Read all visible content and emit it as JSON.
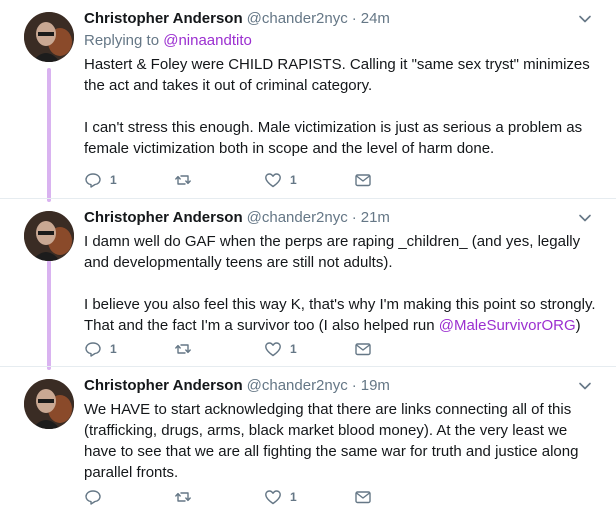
{
  "tweets": [
    {
      "name": "Christopher Anderson",
      "handle": "@chander2nyc",
      "separator": "·",
      "time": "24m",
      "replying_prefix": "Replying to ",
      "replying_to": "@ninaandtito",
      "paragraphs": [
        "Hastert & Foley were CHILD RAPISTS. Calling it \"same sex tryst\" minimizes the act and takes it out of criminal category.",
        "I can't stress this enough. Male victimization is just as serious a problem as female victimization both in scope and the level of harm done."
      ],
      "replies": "1",
      "retweets": "",
      "likes": "1"
    },
    {
      "name": "Christopher Anderson",
      "handle": "@chander2nyc",
      "separator": "·",
      "time": "21m",
      "p1": "I damn well do GAF when the perps are raping _children_ (and yes, legally and developmentally teens are still not adults).",
      "p2_text": "I believe you also feel this way K, that's why I'm making this point so strongly. That and the fact I'm a survivor too (I also helped run ",
      "p2_mention": "@MaleSurvivorORG",
      "p2_end": ")",
      "replies": "1",
      "retweets": "",
      "likes": "1"
    },
    {
      "name": "Christopher Anderson",
      "handle": "@chander2nyc",
      "separator": "·",
      "time": "19m",
      "paragraphs": [
        "We HAVE to start acknowledging that there are links connecting all of this (trafficking, drugs, arms, black market blood money). At the very least we have to see that we are all fighting the same war for truth and justice along parallel fronts."
      ],
      "replies": "",
      "retweets": "",
      "likes": "1"
    }
  ],
  "colors": {
    "thread_line": "#d9b3f0",
    "link": "#9b2fd0",
    "muted": "#657786",
    "text": "#14171a"
  },
  "icons": [
    "reply-icon",
    "retweet-icon",
    "like-icon",
    "dm-icon",
    "caret-down-icon"
  ]
}
